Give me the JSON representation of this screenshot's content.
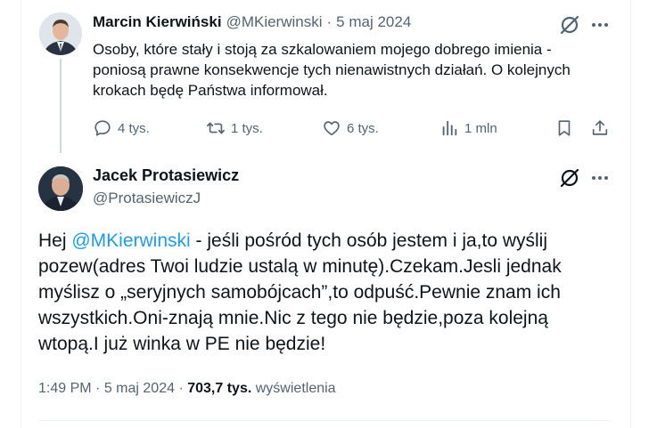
{
  "parent_tweet": {
    "author_name": "Marcin Kierwiński",
    "handle": "@MKierwinski",
    "separator": "·",
    "date": "5 maj 2024",
    "text": "Osoby, które stały i stoją za szkalowaniem mojego dobrego imienia - poniosą prawne konsekwencje tych nienawistnych działań. O kolejnych krokach będę Państwa informował.",
    "replies": "4 tys.",
    "reposts": "1 tys.",
    "likes": "6 tys.",
    "views": "1 mln"
  },
  "main_tweet": {
    "author_name": "Jacek Protasiewicz",
    "handle": "@ProtasiewiczJ",
    "text_prefix": "Hej ",
    "mention": "@MKierwinski",
    "text_rest": " - jeśli pośród tych osób jestem i ja,to wyślij pozew(adres Twoi ludzie ustalą w minutę).Czekam.Jesli jednak myślisz o „seryjnych samobójcach”,to odpuść.Pewnie znam ich wszystkich.Oni-znają mnie.Nic z tego nie będzie,poza kolejną wtopą.I już winka w PE nie będzie!",
    "time": "1:49 PM",
    "separator": "·",
    "date": "5 maj 2024",
    "separator2": "·",
    "views_count": "703,7 tys.",
    "views_label": "wyświetlenia"
  },
  "icons": {
    "grok": "grok-icon",
    "more": "more-icon",
    "reply": "reply-icon",
    "repost": "repost-icon",
    "like": "like-icon",
    "views": "views-icon",
    "bookmark": "bookmark-icon",
    "share": "share-icon"
  },
  "colors": {
    "text": "#0f1419",
    "muted": "#536471",
    "link": "#1d9bf0",
    "divider": "#eff3f4"
  }
}
